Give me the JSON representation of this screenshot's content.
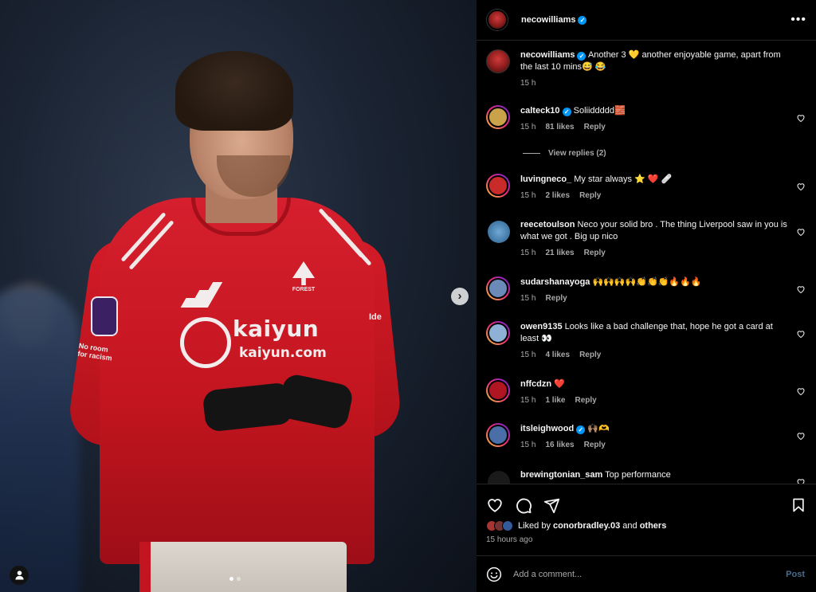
{
  "post": {
    "author": "necowilliams",
    "caption": "Another 3 💛 another enjoyable game, apart from the last 10 mins😅 😂",
    "caption_time": "15 h",
    "liked_by_prefix": "Liked by",
    "liked_by_user": "conorbradley.03",
    "liked_by_and": "and",
    "liked_by_others": "others",
    "posted_ago": "15 hours ago"
  },
  "image": {
    "sponsor_big": "kaiyun",
    "sponsor_small": "kaiyun.com",
    "crest_text": "FOREST",
    "sleeve_text": "No room for racism",
    "sleeve_right": "Ide"
  },
  "comments": [
    {
      "user": "calteck10",
      "verified": true,
      "text": "Soliiddddd🧱",
      "time": "15 h",
      "likes": "81 likes",
      "reply": "Reply",
      "avatar_color": "#c9a24a"
    },
    {
      "user": "luvingneco_",
      "verified": false,
      "text": "My star always ⭐ ❤️ 🩹",
      "time": "15 h",
      "likes": "2 likes",
      "reply": "Reply",
      "avatar_color": "#c92a2a"
    },
    {
      "user": "reecetoulson",
      "verified": false,
      "text": "Neco your solid bro . The thing Liverpool saw in you is what we got . Big up nico",
      "time": "15 h",
      "likes": "21 likes",
      "reply": "Reply",
      "avatar_color": "#3a78b0"
    },
    {
      "user": "sudarshanayoga",
      "verified": false,
      "text": "🙌🙌🙌🙌👏👏👏🔥🔥🔥",
      "time": "15 h",
      "likes": "",
      "reply": "Reply",
      "avatar_color": "#6b8ab8"
    },
    {
      "user": "owen9135",
      "verified": false,
      "text": "Looks like a bad challenge that, hope he got a card at least 👀",
      "time": "15 h",
      "likes": "4 likes",
      "reply": "Reply",
      "avatar_color": "#8fb1d6"
    },
    {
      "user": "nffcdzn",
      "verified": false,
      "text": "❤️",
      "time": "15 h",
      "likes": "1 like",
      "reply": "Reply",
      "avatar_color": "#b01622"
    },
    {
      "user": "itsleighwood",
      "verified": true,
      "text": "🙌🏽🫶",
      "time": "15 h",
      "likes": "16 likes",
      "reply": "Reply",
      "avatar_color": "#4a6fa8"
    },
    {
      "user": "brewingtonian_sam",
      "verified": false,
      "text": "Top performance",
      "time": "",
      "likes": "",
      "reply": "",
      "avatar_color": "#222"
    }
  ],
  "view_replies": "View replies (2)",
  "composer": {
    "placeholder": "Add a comment...",
    "post_label": "Post"
  },
  "icons": {
    "more": "more-options-icon",
    "next": "chevron-right-icon",
    "like": "heart-icon",
    "comment": "comment-icon",
    "share": "share-icon",
    "save": "bookmark-icon",
    "emoji": "emoji-icon",
    "tags": "user-tag-icon"
  },
  "colors": {
    "verified": "#0095f6",
    "post_button": "#4a6c8f",
    "secondary_text": "#a8a8a8"
  }
}
